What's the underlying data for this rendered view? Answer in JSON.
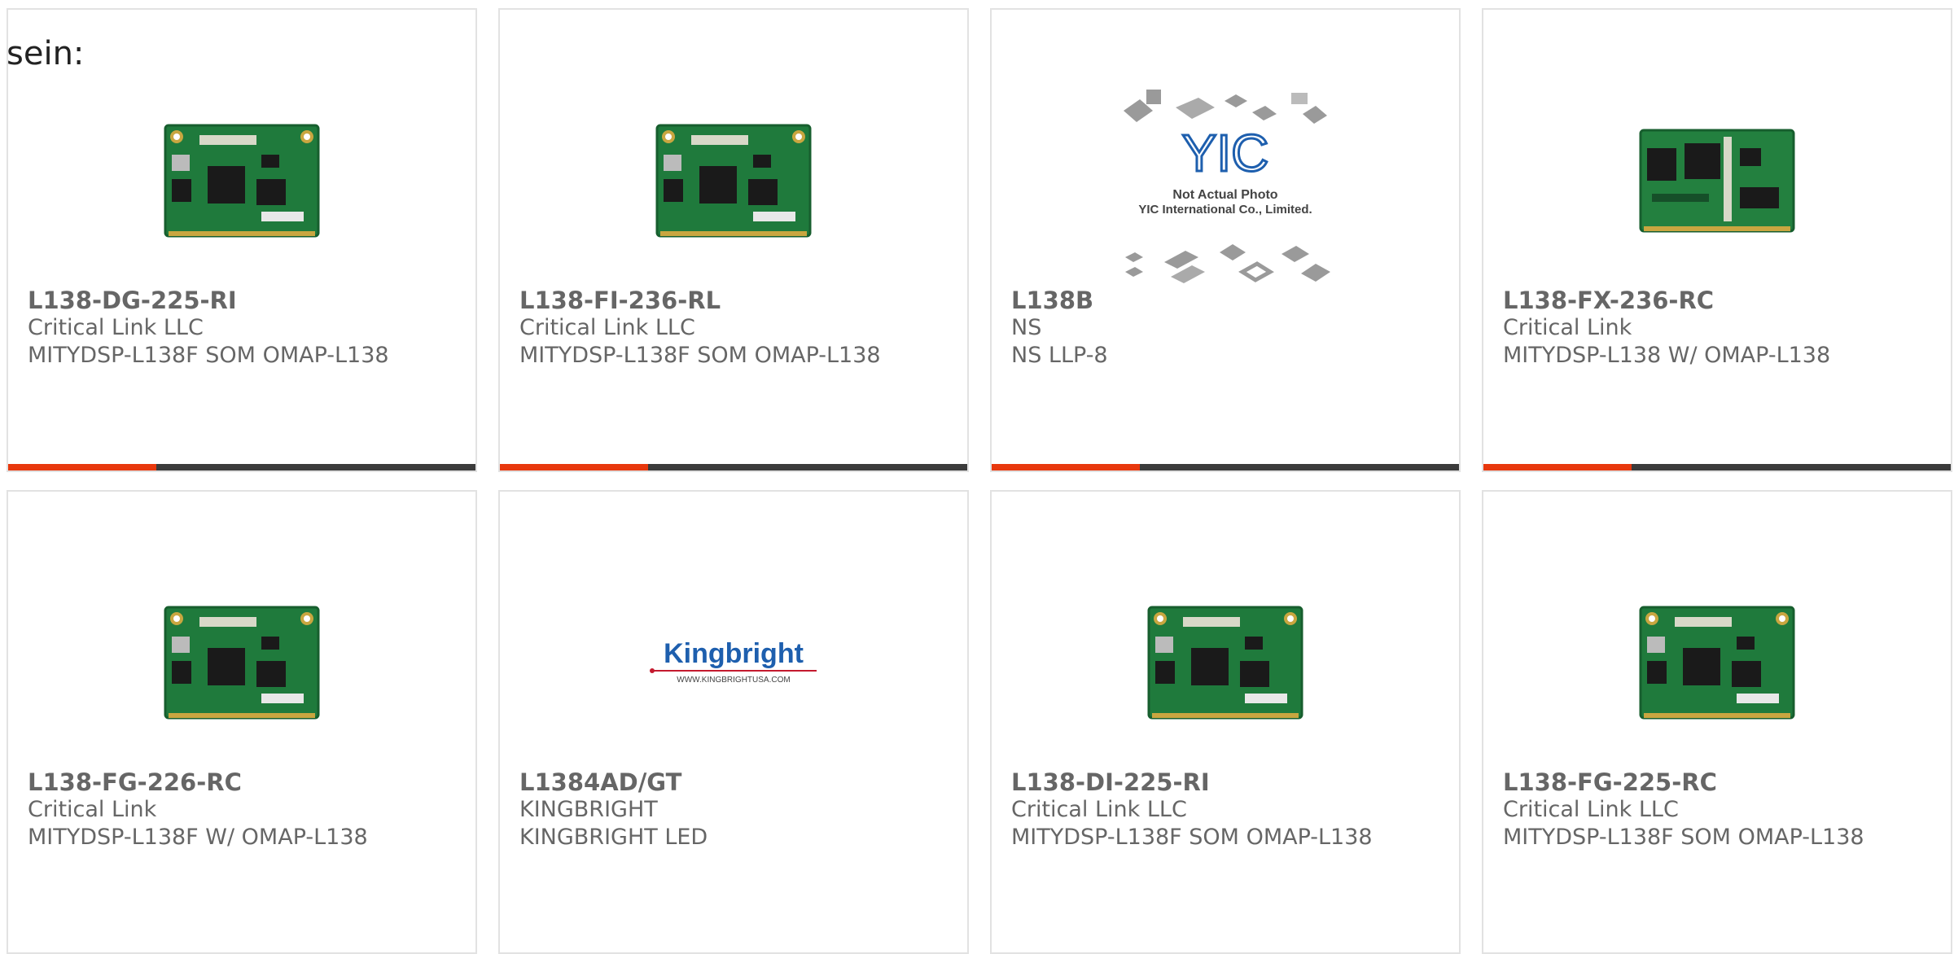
{
  "intro_text": "sein:",
  "colors": {
    "accent": "#e8380d",
    "bar": "#3b3b3b",
    "text": "#666666",
    "pcb_green": "#1f7a3c"
  },
  "products": [
    {
      "part_number": "L138-DG-225-RI",
      "manufacturer": "Critical Link LLC",
      "description": "MITYDSP-L138F SOM OMAP-L138",
      "image": "pcb-module"
    },
    {
      "part_number": "L138-FI-236-RL",
      "manufacturer": "Critical Link LLC",
      "description": "MITYDSP-L138F SOM OMAP-L138",
      "image": "pcb-module"
    },
    {
      "part_number": "L138B",
      "manufacturer": "NS",
      "description": "NS LLP-8",
      "image": "yic-placeholder",
      "placeholder_text": {
        "logo": "YIC",
        "line1": "Not Actual Photo",
        "line2": "YIC International Co., Limited."
      }
    },
    {
      "part_number": "L138-FX-236-RC",
      "manufacturer": "Critical Link",
      "description": "MITYDSP-L138 W/ OMAP-L138",
      "image": "pcb-module"
    },
    {
      "part_number": "L138-FG-226-RC",
      "manufacturer": "Critical Link",
      "description": "MITYDSP-L138F W/ OMAP-L138",
      "image": "pcb-module"
    },
    {
      "part_number": "L1384AD/GT",
      "manufacturer": "KINGBRIGHT",
      "description": "KINGBRIGHT LED",
      "image": "kingbright-logo",
      "logo_text": {
        "brand": "Kingbright",
        "url": "WWW.KINGBRIGHTUSA.COM"
      }
    },
    {
      "part_number": "L138-DI-225-RI",
      "manufacturer": "Critical Link LLC",
      "description": "MITYDSP-L138F SOM OMAP-L138",
      "image": "pcb-module"
    },
    {
      "part_number": "L138-FG-225-RC",
      "manufacturer": "Critical Link LLC",
      "description": "MITYDSP-L138F SOM OMAP-L138",
      "image": "pcb-module"
    }
  ]
}
